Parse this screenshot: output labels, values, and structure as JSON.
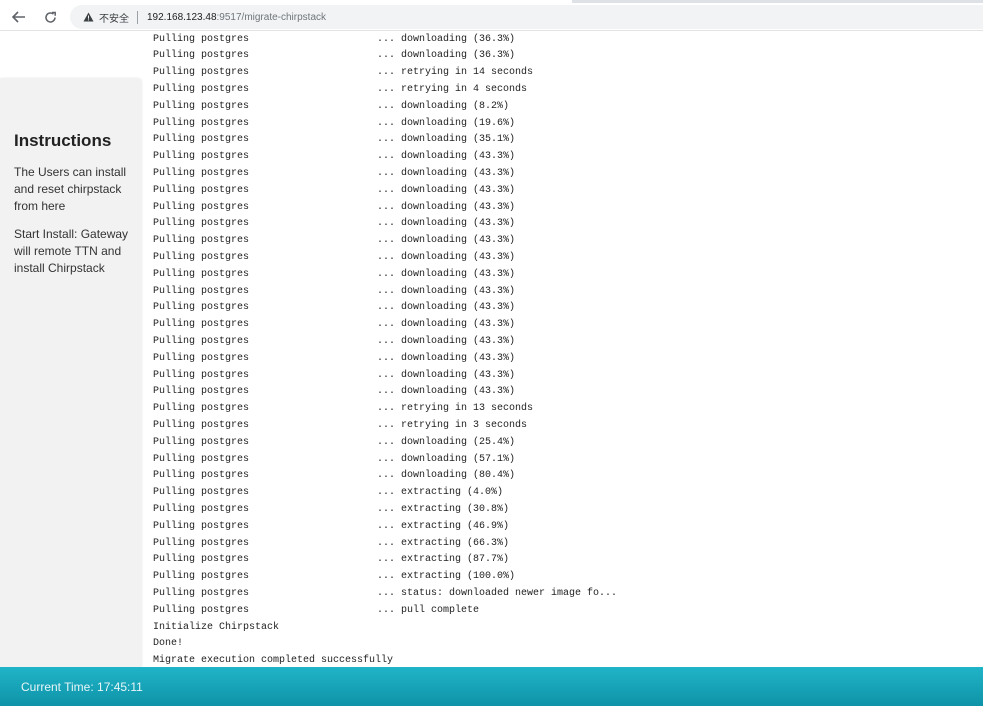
{
  "browser": {
    "security_label": "不安全",
    "url_host": "192.168.123.48",
    "url_path": ":9517/migrate-chirpstack"
  },
  "sidebar": {
    "title": "Instructions",
    "paragraph1": "The Users can install and reset chirpstack from here",
    "paragraph2": "Start Install: Gateway will remote TTN and install Chirpstack"
  },
  "log": [
    {
      "service": "Pulling postgres",
      "status": "... downloading (36.3%)"
    },
    {
      "service": "Pulling postgres",
      "status": "... downloading (36.3%)"
    },
    {
      "service": "Pulling postgres",
      "status": "... retrying in 14 seconds"
    },
    {
      "service": "Pulling postgres",
      "status": "... retrying in 4 seconds"
    },
    {
      "service": "Pulling postgres",
      "status": "... downloading (8.2%)"
    },
    {
      "service": "Pulling postgres",
      "status": "... downloading (19.6%)"
    },
    {
      "service": "Pulling postgres",
      "status": "... downloading (35.1%)"
    },
    {
      "service": "Pulling postgres",
      "status": "... downloading (43.3%)"
    },
    {
      "service": "Pulling postgres",
      "status": "... downloading (43.3%)"
    },
    {
      "service": "Pulling postgres",
      "status": "... downloading (43.3%)"
    },
    {
      "service": "Pulling postgres",
      "status": "... downloading (43.3%)"
    },
    {
      "service": "Pulling postgres",
      "status": "... downloading (43.3%)"
    },
    {
      "service": "Pulling postgres",
      "status": "... downloading (43.3%)"
    },
    {
      "service": "Pulling postgres",
      "status": "... downloading (43.3%)"
    },
    {
      "service": "Pulling postgres",
      "status": "... downloading (43.3%)"
    },
    {
      "service": "Pulling postgres",
      "status": "... downloading (43.3%)"
    },
    {
      "service": "Pulling postgres",
      "status": "... downloading (43.3%)"
    },
    {
      "service": "Pulling postgres",
      "status": "... downloading (43.3%)"
    },
    {
      "service": "Pulling postgres",
      "status": "... downloading (43.3%)"
    },
    {
      "service": "Pulling postgres",
      "status": "... downloading (43.3%)"
    },
    {
      "service": "Pulling postgres",
      "status": "... downloading (43.3%)"
    },
    {
      "service": "Pulling postgres",
      "status": "... downloading (43.3%)"
    },
    {
      "service": "Pulling postgres",
      "status": "... retrying in 13 seconds"
    },
    {
      "service": "Pulling postgres",
      "status": "... retrying in 3 seconds"
    },
    {
      "service": "Pulling postgres",
      "status": "... downloading (25.4%)"
    },
    {
      "service": "Pulling postgres",
      "status": "... downloading (57.1%)"
    },
    {
      "service": "Pulling postgres",
      "status": "... downloading (80.4%)"
    },
    {
      "service": "Pulling postgres",
      "status": "... extracting (4.0%)"
    },
    {
      "service": "Pulling postgres",
      "status": "... extracting (30.8%)"
    },
    {
      "service": "Pulling postgres",
      "status": "... extracting (46.9%)"
    },
    {
      "service": "Pulling postgres",
      "status": "... extracting (66.3%)"
    },
    {
      "service": "Pulling postgres",
      "status": "... extracting (87.7%)"
    },
    {
      "service": "Pulling postgres",
      "status": "... extracting (100.0%)"
    },
    {
      "service": "Pulling postgres",
      "status": "... status: downloaded newer image fo..."
    },
    {
      "service": "Pulling postgres",
      "status": "... pull complete"
    },
    {
      "service": "Initialize Chirpstack",
      "status": ""
    },
    {
      "service": "Done!",
      "status": ""
    },
    {
      "service": "Migrate execution completed successfully",
      "status": ""
    }
  ],
  "footer": {
    "current_time": "Current Time: 17:45:11"
  }
}
